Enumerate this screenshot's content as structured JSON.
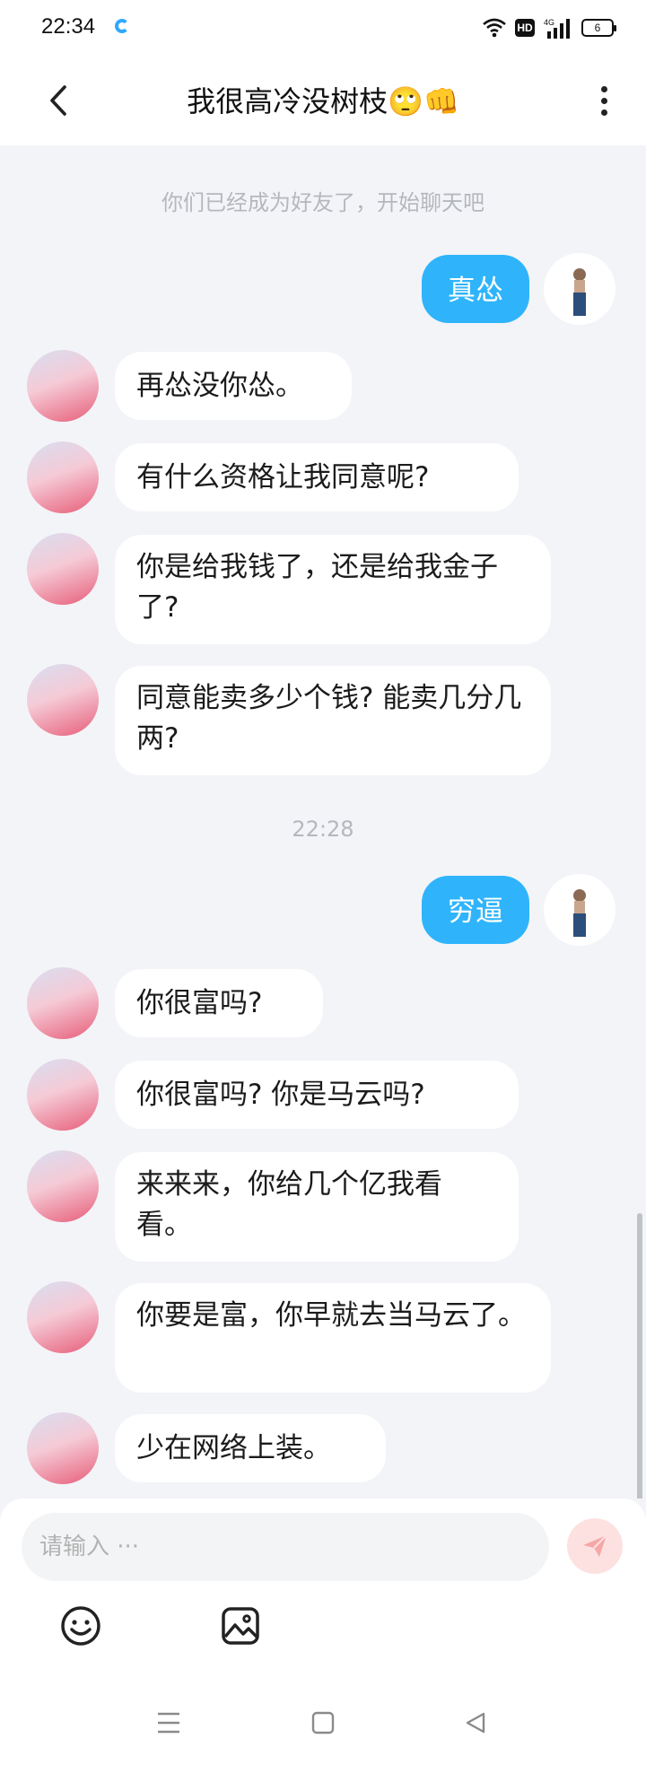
{
  "status_bar": {
    "time": "22:34",
    "hd_label": "HD",
    "network_label": "4G",
    "battery_level": "6"
  },
  "header": {
    "title": "我很高冷没树枝🙄👊"
  },
  "chat": {
    "system_note": "你们已经成为好友了，开始聊天吧",
    "time_divider": "22:28",
    "messages": [
      {
        "from": "me",
        "text": "真怂"
      },
      {
        "from": "other",
        "text": "再怂没你怂。"
      },
      {
        "from": "other",
        "text": "有什么资格让我同意呢?"
      },
      {
        "from": "other",
        "text": "你是给我钱了，还是给我金子了?"
      },
      {
        "from": "other",
        "text": "同意能卖多少个钱? 能卖几分几两?"
      },
      {
        "from": "me",
        "text": "穷逼"
      },
      {
        "from": "other",
        "text": "你很富吗?"
      },
      {
        "from": "other",
        "text": "你很富吗? 你是马云吗?"
      },
      {
        "from": "other",
        "text": "来来来，你给几个亿我看看。"
      },
      {
        "from": "other",
        "text": "你要是富，你早就去当马云了。"
      },
      {
        "from": "other",
        "text": "少在网络上装。"
      }
    ]
  },
  "input_bar": {
    "placeholder": "请输入 ···"
  },
  "colors": {
    "accent": "#2fb4fb",
    "background": "#f3f4f8",
    "send_button": "#fde1e1"
  },
  "icons": [
    "back-arrow-icon",
    "more-vertical-icon",
    "send-icon",
    "emoji-icon",
    "image-icon",
    "menu-icon",
    "home-icon",
    "back-triangle-icon"
  ]
}
